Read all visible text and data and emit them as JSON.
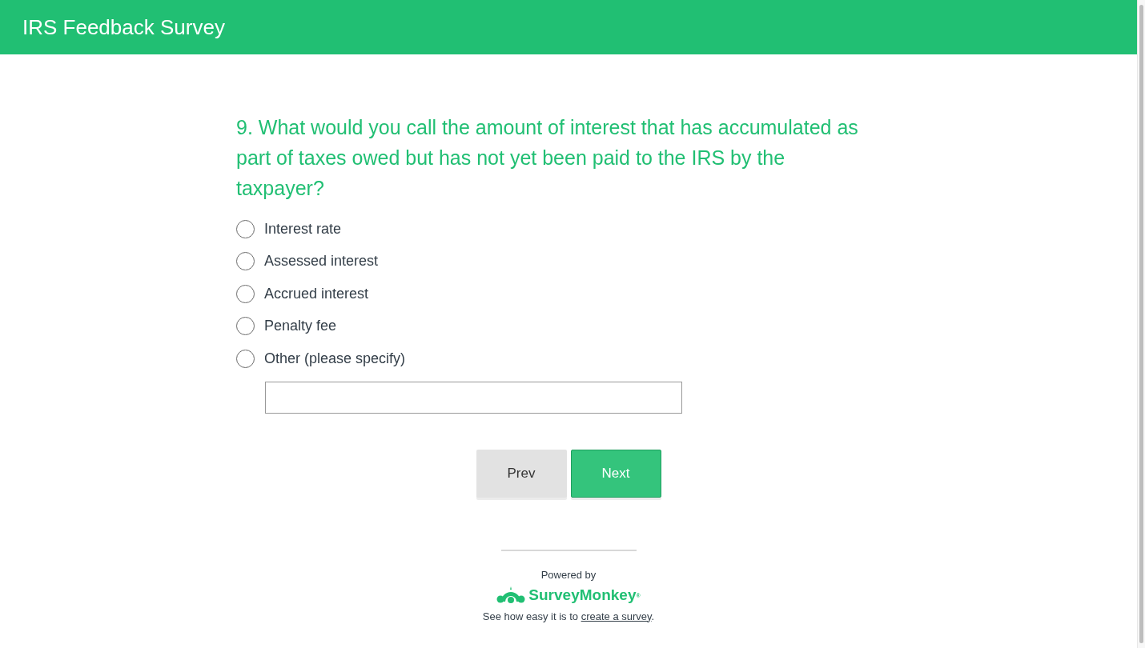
{
  "header": {
    "title": "IRS Feedback Survey"
  },
  "question": {
    "text": "9. What would you call the amount of interest that has accumulated as part of taxes owed but has not yet been paid to the IRS by the taxpayer?"
  },
  "options": [
    {
      "label": "Interest rate",
      "selected": false
    },
    {
      "label": "Assessed interest",
      "selected": false
    },
    {
      "label": "Accrued interest",
      "selected": false
    },
    {
      "label": "Penalty fee",
      "selected": false
    },
    {
      "label": "Other (please specify)",
      "selected": false
    }
  ],
  "buttons": [
    {
      "label": "Prev",
      "kind": "secondary"
    },
    {
      "label": "Next",
      "kind": "primary"
    }
  ],
  "footer": {
    "powered_by": "Powered by",
    "logo": "SurveyMonkey$^{®}$",
    "text_before": "See how easy it is to ",
    "link": "create a survey",
    "text_after": "."
  }
}
